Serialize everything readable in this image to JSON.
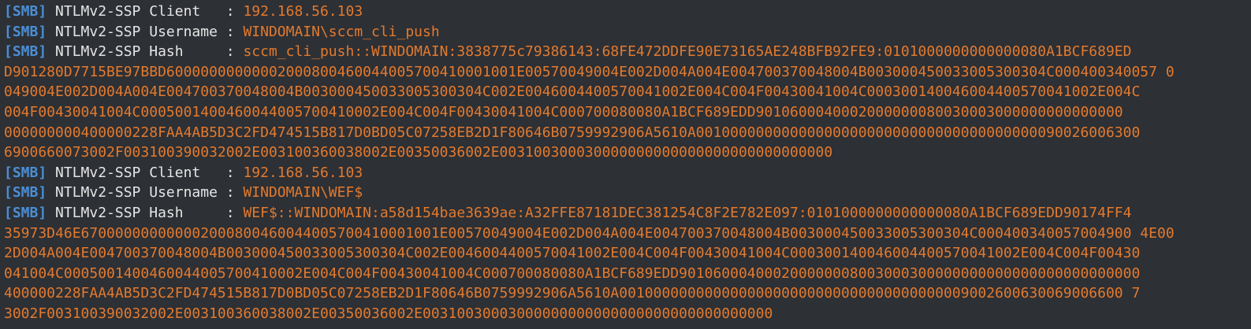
{
  "colors": {
    "background": "#2d3035",
    "tag": "#4a8fd6",
    "label": "#e6e6e6",
    "value": "#e37a2e"
  },
  "lines": [
    {
      "tag": "[SMB]",
      "label": " NTLMv2-SSP Client   : ",
      "value": "192.168.56.103"
    },
    {
      "tag": "[SMB]",
      "label": " NTLMv2-SSP Username : ",
      "value": "WINDOMAIN\\sccm_cli_push"
    },
    {
      "tag": "[SMB]",
      "label": " NTLMv2-SSP Hash     : ",
      "value": "sccm_cli_push::WINDOMAIN:3838775c79386143:68FE472DDFE90E73165AE248BFB92FE9:0101000000000000080A1BCF689ED"
    },
    {
      "tag": "",
      "label": "",
      "value": "D901280D7715BE97BBD60000000000002000800460044005700410001001E00570049004E002D004A004E004700370048004B003000450033005300304C000400340057 0"
    },
    {
      "tag": "",
      "label": "",
      "value": "049004E002D004A004E004700370048004B003000450033005300304C002E0046004400570041002E004C004F00430041004C000300140046004400570041002E004C"
    },
    {
      "tag": "",
      "label": "",
      "value": "004F00430041004C0005001400460044005700410002E004C004F00430041004C000700080080A1BCF689EDD9010600040002000000080030003000000000000000"
    },
    {
      "tag": "",
      "label": "",
      "value": "000000000400000228FAA4AB5D3C2FD474515B817D0BD05C07258EB2D1F80646B0759992906A5610A0010000000000000000000000000000000000000090026006300"
    },
    {
      "tag": "",
      "label": "",
      "value": "6900660073002F003100390032002E003100360038002E00350036002E003100300030000000000000000000000000000"
    },
    {
      "tag": "[SMB]",
      "label": " NTLMv2-SSP Client   : ",
      "value": "192.168.56.103"
    },
    {
      "tag": "[SMB]",
      "label": " NTLMv2-SSP Username : ",
      "value": "WINDOMAIN\\WEF$"
    },
    {
      "tag": "[SMB]",
      "label": " NTLMv2-SSP Hash     : ",
      "value": "WEF$::WINDOMAIN:a58d154bae3639ae:A32FFE87181DEC381254C8F2E782E097:0101000000000000080A1BCF689EDD90174FF4"
    },
    {
      "tag": "",
      "label": "",
      "value": "35973D46E670000000000002000800460044005700410001001E00570049004E002D004A004E004700370048004B003000450033005300304C000400340057004900 4E00"
    },
    {
      "tag": "",
      "label": "",
      "value": "2D004A004E004700370048004B003000450033005300304C002E0046004400570041002E004C004F00430041004C000300140046004400570041002E004C004F00430"
    },
    {
      "tag": "",
      "label": "",
      "value": "041004C0005001400460044005700410002E004C004F00430041004C000700080080A1BCF689EDD901060004000200000008003000300000000000000000000000000"
    },
    {
      "tag": "",
      "label": "",
      "value": "400000228FAA4AB5D3C2FD474515B817D0BD05C07258EB2D1F80646B0759992906A5610A00100000000000000000000000000000000000009002600630069006600 7"
    },
    {
      "tag": "",
      "label": "",
      "value": "3002F003100390032002E003100360038002E00350036002E00310030003000000000000000000000000000000"
    }
  ]
}
